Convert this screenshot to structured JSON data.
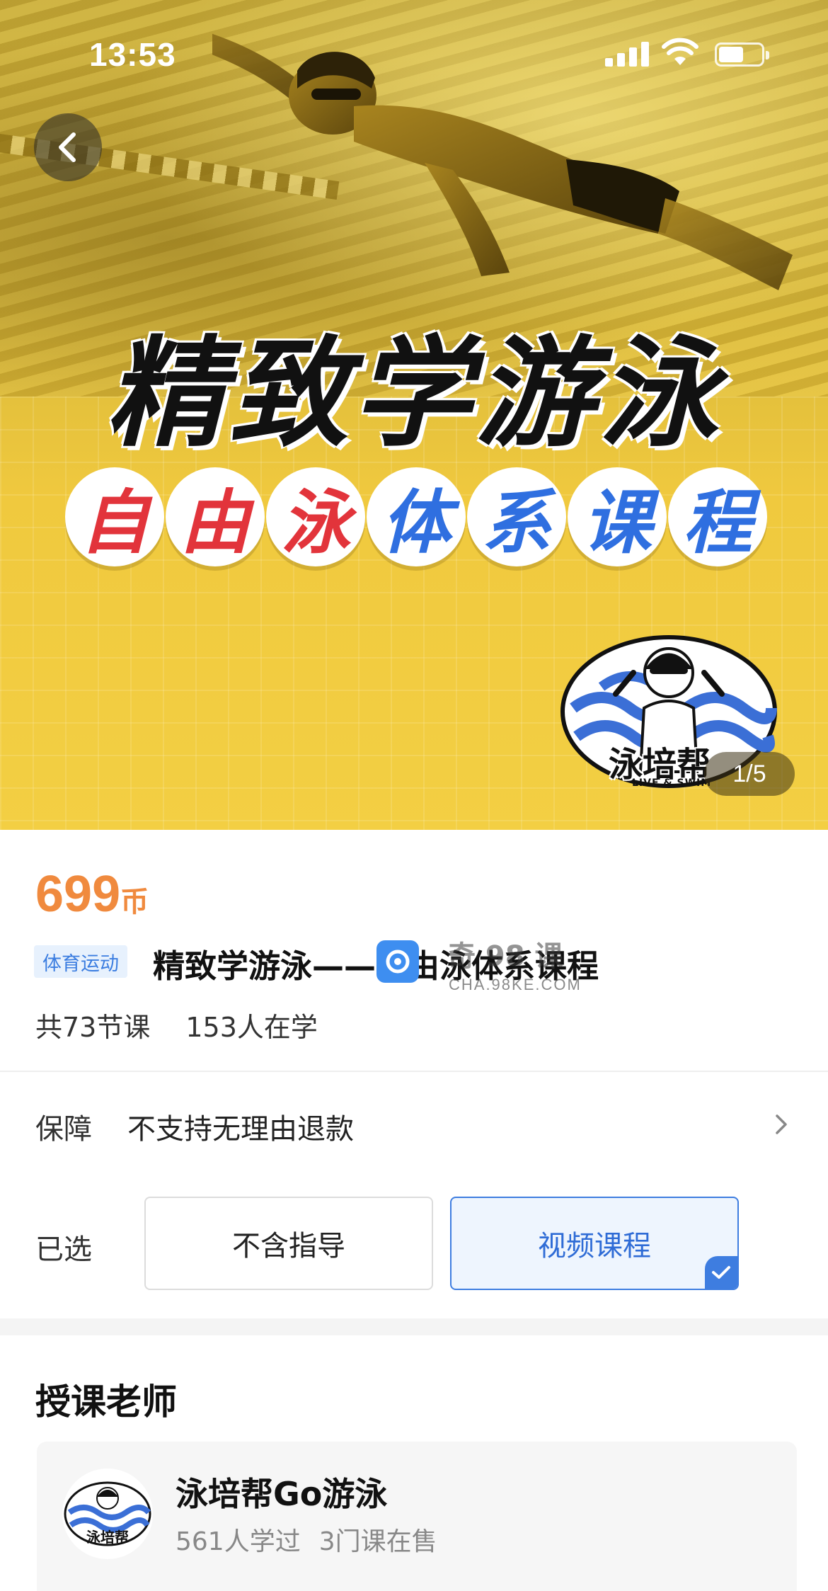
{
  "status_bar": {
    "time": "13:53"
  },
  "hero": {
    "title": "精致学游泳",
    "pills": [
      {
        "char": "自",
        "color": "red"
      },
      {
        "char": "由",
        "color": "red"
      },
      {
        "char": "泳",
        "color": "red"
      },
      {
        "char": "体",
        "color": "blue"
      },
      {
        "char": "系",
        "color": "blue"
      },
      {
        "char": "课",
        "color": "blue"
      },
      {
        "char": "程",
        "color": "blue"
      }
    ],
    "logo_text": "泳培帮",
    "logo_sub": "LIVE & SWIM",
    "counter": "1/5"
  },
  "product": {
    "price": "699",
    "price_unit": "币",
    "category": "体育运动",
    "title": "精致学游泳——自由泳体系课程",
    "lessons": "共73节课",
    "learners": "153人在学"
  },
  "watermark": {
    "text": "奇 98 课",
    "url": "CHA.98KE.COM"
  },
  "guarantee": {
    "label": "保障",
    "value": "不支持无理由退款"
  },
  "selection": {
    "label": "已选",
    "options": [
      {
        "label": "不含指导",
        "active": false
      },
      {
        "label": "视频课程",
        "active": true
      }
    ]
  },
  "teacher": {
    "heading": "授课老师",
    "name": "泳培帮Go游泳",
    "learned": "561人学过",
    "courses": "3门课在售"
  },
  "colors": {
    "price": "#f08a3e",
    "accent_blue": "#3e7de0",
    "hero_yellow": "#f3cf43",
    "pill_red": "#e2343b",
    "pill_blue": "#2f6fe0"
  }
}
